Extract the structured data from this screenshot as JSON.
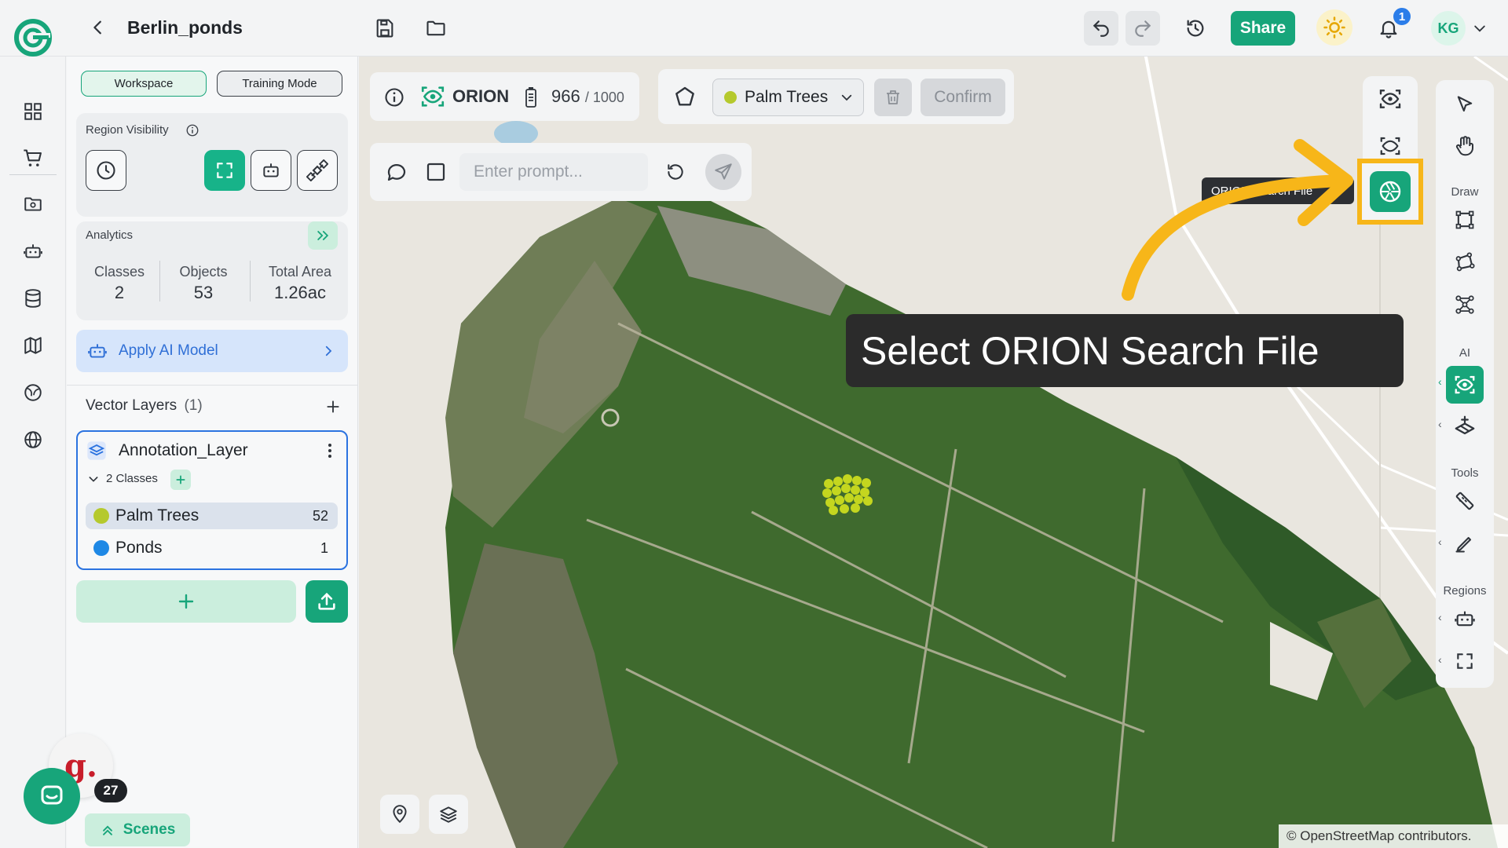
{
  "app": {
    "project_title": "Berlin_ponds"
  },
  "topbar": {
    "share_label": "Share",
    "notification_count": "1",
    "user_initials": "KG"
  },
  "panel": {
    "modes": {
      "workspace": "Workspace",
      "training": "Training Mode"
    },
    "region_visibility": {
      "title": "Region Visibility"
    },
    "analytics": {
      "title": "Analytics",
      "classes_label": "Classes",
      "classes_value": "2",
      "objects_label": "Objects",
      "objects_value": "53",
      "area_label": "Total Area",
      "area_value": "1.26ac"
    },
    "apply_ai_label": "Apply AI Model",
    "vector_layers": {
      "title": "Vector Layers",
      "count": "(1)"
    },
    "layer": {
      "name": "Annotation_Layer",
      "classes_summary": "2 Classes",
      "classes": [
        {
          "name": "Palm Trees",
          "count": "52",
          "color": "#b5c92d"
        },
        {
          "name": "Ponds",
          "count": "1",
          "color": "#1e88e5"
        }
      ]
    }
  },
  "map_toolbar": {
    "orion_label": "ORION",
    "credits_used": "966",
    "credits_total": "/ 1000",
    "selected_class": "Palm Trees",
    "confirm_label": "Confirm",
    "prompt_placeholder": "Enter prompt..."
  },
  "right_rail": {
    "draw_title": "Draw",
    "ai_title": "AI",
    "tools_title": "Tools",
    "regions_title": "Regions"
  },
  "tooltip_text": "ORION Search File",
  "callout_text": "Select ORION Search File",
  "attribution": "© OpenStreetMap contributors.",
  "bottom": {
    "g_badge": "g.",
    "g_count": "27",
    "scenes_label": "Scenes"
  },
  "colors": {
    "brand_green": "#17a57a",
    "highlight_yellow": "#f7b619",
    "layer_blue": "#2b73e0"
  }
}
